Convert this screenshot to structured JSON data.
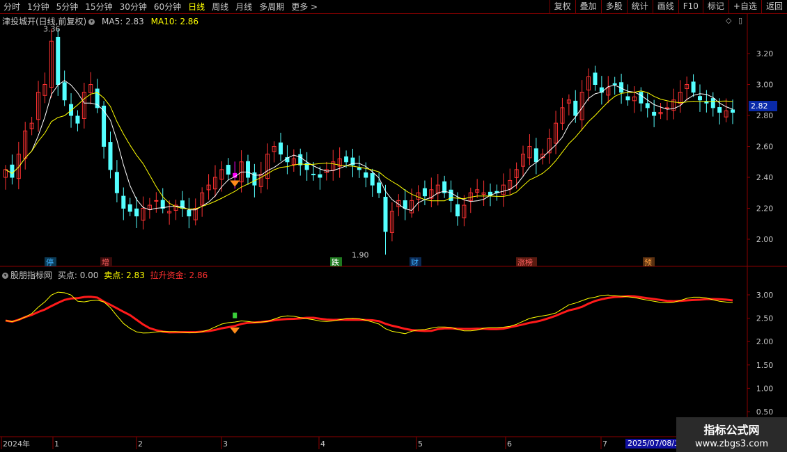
{
  "toolbar": {
    "periods": [
      "分时",
      "1分钟",
      "5分钟",
      "15分钟",
      "30分钟",
      "60分钟",
      "日线",
      "周线",
      "月线",
      "多周期",
      "更多 >"
    ],
    "active_index": 6,
    "right_buttons": [
      "复权",
      "叠加",
      "多股",
      "统计",
      "画线",
      "F10",
      "标记",
      "+自选",
      "返回"
    ]
  },
  "main_chart": {
    "title": "津投城开(日线,前复权)",
    "ma5_label": "MA5: 2.83",
    "ma10_label": "MA10: 2.86",
    "y_ticks": [
      "3.20",
      "3.00",
      "2.80",
      "2.60",
      "2.40",
      "2.20",
      "2.00"
    ],
    "current_price": "2.82",
    "high_label": "3.36",
    "low_label": "1.90",
    "event_tags": [
      {
        "text": "停",
        "color": "#3fb0ff",
        "bg": "#0b3a55"
      },
      {
        "text": "增",
        "color": "#ff6060",
        "bg": "#3a0b0b"
      },
      {
        "text": "跌",
        "color": "#ffffff",
        "bg": "#1f7a1f"
      },
      {
        "text": "财",
        "color": "#3fb0ff",
        "bg": "#0b2a55"
      },
      {
        "text": "涨榜",
        "color": "#ff6060",
        "bg": "#5a1a10"
      },
      {
        "text": "预",
        "color": "#ffa040",
        "bg": "#5a3010"
      }
    ]
  },
  "indicator": {
    "title": "股朋指标网",
    "buy_label": "买点: 0.00",
    "sell_label": "卖点: 2.83",
    "fund_label": "拉升资金: 2.86",
    "y_ticks": [
      "3.00",
      "2.50",
      "2.00",
      "1.50",
      "1.00",
      "0.50"
    ]
  },
  "x_axis": {
    "labels": [
      "2024年",
      "1",
      "2",
      "3",
      "4",
      "5",
      "6",
      "7"
    ],
    "date_box": "2025/07/08/二"
  },
  "watermark": {
    "line1": "指标公式网",
    "line2": "www.zbgs3.com"
  },
  "colors": {
    "up": "#ff3232",
    "down": "#54ffff",
    "ma5": "#ffffff",
    "ma10": "#ffff00",
    "grid_border": "#8b0000",
    "signal": "#ff00ff"
  },
  "chart_data": {
    "type": "candlestick",
    "ylim": [
      1.9,
      3.36
    ],
    "closes": [
      2.45,
      2.4,
      2.55,
      2.7,
      2.75,
      2.95,
      3.0,
      3.28,
      3.0,
      2.9,
      2.8,
      2.75,
      2.95,
      3.0,
      2.85,
      2.6,
      2.45,
      2.3,
      2.2,
      2.18,
      2.15,
      2.2,
      2.22,
      2.25,
      2.2,
      2.18,
      2.22,
      2.2,
      2.15,
      2.2,
      2.3,
      2.35,
      2.4,
      2.45,
      2.42,
      2.4,
      2.5,
      2.4,
      2.35,
      2.42,
      2.55,
      2.6,
      2.55,
      2.5,
      2.52,
      2.48,
      2.45,
      2.42,
      2.4,
      2.45,
      2.5,
      2.52,
      2.5,
      2.48,
      2.45,
      2.4,
      2.35,
      2.3,
      2.05,
      2.18,
      2.25,
      2.2,
      2.25,
      2.3,
      2.28,
      2.32,
      2.35,
      2.3,
      2.25,
      2.15,
      2.22,
      2.3,
      2.32,
      2.3,
      2.28,
      2.3,
      2.35,
      2.38,
      2.45,
      2.55,
      2.6,
      2.5,
      2.55,
      2.65,
      2.75,
      2.85,
      2.9,
      2.8,
      2.95,
      3.05,
      3.0,
      2.95,
      2.98,
      3.0,
      2.95,
      2.9,
      2.92,
      2.88,
      2.85,
      2.8,
      2.82,
      2.85,
      2.9,
      2.95,
      3.0,
      2.95,
      2.9,
      2.88,
      2.85,
      2.82,
      2.83,
      2.82
    ],
    "ma5_last": 2.83,
    "ma10_last": 2.86,
    "indicator_buy": 0.0,
    "indicator_sell": 2.83,
    "indicator_fund": 2.86
  }
}
